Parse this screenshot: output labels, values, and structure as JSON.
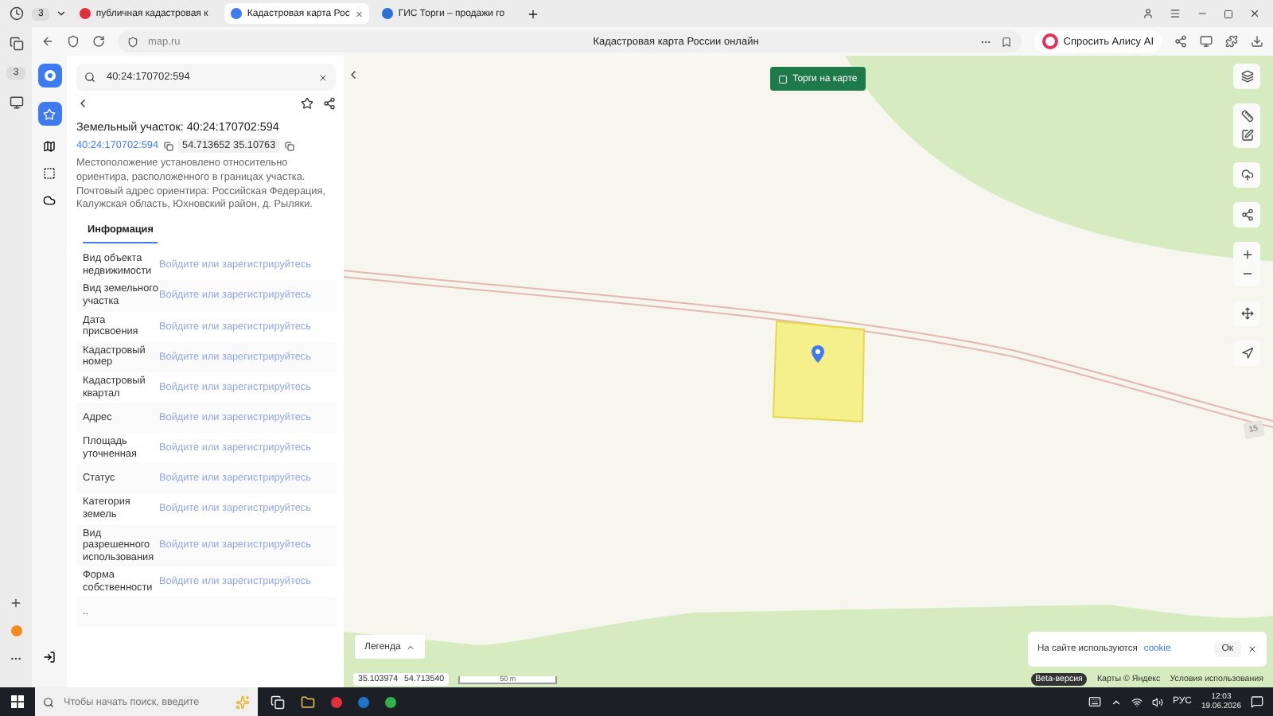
{
  "browser": {
    "tab_count": "3",
    "tabs": [
      {
        "title": "публичная кадастровая к",
        "selected": false
      },
      {
        "title": "Кадастровая карта Рос",
        "selected": true
      },
      {
        "title": "ГИС Торги – продажи го",
        "selected": false
      }
    ],
    "address": "map.ru",
    "page_title": "Кадастровая карта России онлайн",
    "ask_button": "Спросить Алису AI",
    "sidebar_badge": "3"
  },
  "search": {
    "value": "40:24:170702:594"
  },
  "parcel": {
    "title": "Земельный участок: 40:24:170702:594",
    "cad_number": "40:24:170702:594",
    "coords": "54.713652 35.10763",
    "description": "Местоположение установлено относительно ориентира, расположенного в границах участка. Почтовый адрес ориентира: Российская Федерация, Калужская область, Юхновский район, д. Рыляки."
  },
  "info_tabs": [
    {
      "label": "Информация",
      "selected": true
    }
  ],
  "attributes": [
    {
      "label": "Вид объекта недвижимости",
      "value": "Войдите или зарегистрируйтесь"
    },
    {
      "label": "Вид земельного участка",
      "value": "Войдите или зарегистрируйтесь"
    },
    {
      "label": "Дата присвоения",
      "value": "Войдите или зарегистрируйтесь"
    },
    {
      "label": "Кадастровый номер",
      "value": "Войдите или зарегистрируйтесь"
    },
    {
      "label": "Кадастровый квартал",
      "value": "Войдите или зарегистрируйтесь"
    },
    {
      "label": "Адрес",
      "value": "Войдите или зарегистрируйтесь"
    },
    {
      "label": "Площадь уточненная",
      "value": "Войдите или зарегистрируйтесь"
    },
    {
      "label": "Статус",
      "value": "Войдите или зарегистрируйтесь"
    },
    {
      "label": "Категория земель",
      "value": "Войдите или зарегистрируйтесь"
    },
    {
      "label": "Вид разрешенного использования",
      "value": "Войдите или зарегистрируйтесь"
    },
    {
      "label": "Форма собственности",
      "value": "Войдите или зарегистрируйтесь"
    },
    {
      "label": ".."
    }
  ],
  "map": {
    "auction_button": "Торги на карте",
    "legend": "Легенда",
    "lon": "35.103974",
    "lat": "54.713540",
    "scale": "50 m",
    "tile_label": "15",
    "cookie_text": "На сайте используются",
    "cookie_link": "cookie",
    "cookie_ok": "Ок",
    "beta": "Beta-версия",
    "copyright": "Карты © Яндекс",
    "terms": "Условия использования"
  },
  "taskbar": {
    "search_placeholder": "Чтобы начать поиск, введите",
    "language": "РУС",
    "time": "12:03",
    "date": "19.06.2026"
  }
}
